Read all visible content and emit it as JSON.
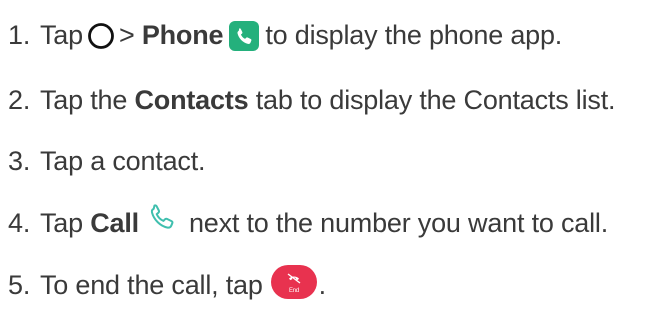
{
  "steps": [
    {
      "number": "1.",
      "text_before": "Tap",
      "text_mid": ">",
      "bold": "Phone",
      "text_after": "to display the phone app.",
      "icons": [
        "home-circle-icon",
        "phone-app-icon"
      ]
    },
    {
      "number": "2.",
      "text_before": "Tap the",
      "bold": "Contacts",
      "text_after": "tab to display the Contacts list."
    },
    {
      "number": "3.",
      "text": "Tap a contact."
    },
    {
      "number": "4.",
      "text_before": "Tap",
      "bold": "Call",
      "text_after": "next to the number you want to call.",
      "icons": [
        "call-handset-icon"
      ]
    },
    {
      "number": "5.",
      "text_before": "To end the call, tap",
      "text_after": ".",
      "end_label": "End",
      "icons": [
        "end-call-icon"
      ]
    }
  ],
  "colors": {
    "text": "#3a3a3a",
    "phone_green": "#24b07c",
    "call_teal": "#3fbfae",
    "end_red": "#e8324f"
  }
}
